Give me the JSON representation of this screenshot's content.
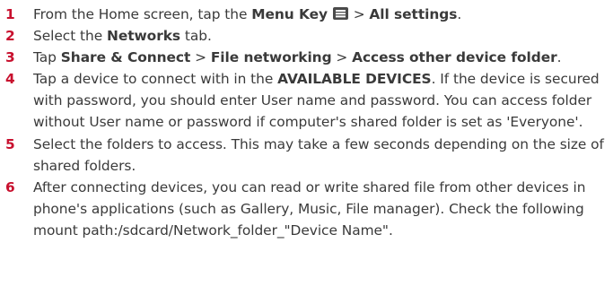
{
  "steps": [
    {
      "num": "1",
      "parts": [
        {
          "t": "From the Home screen, tap the "
        },
        {
          "t": "Menu Key",
          "b": true
        },
        {
          "t": " "
        },
        {
          "icon": "menu-key-icon"
        },
        {
          "t": " > "
        },
        {
          "t": "All settings",
          "b": true
        },
        {
          "t": "."
        }
      ]
    },
    {
      "num": "2",
      "parts": [
        {
          "t": "Select the "
        },
        {
          "t": "Networks",
          "b": true
        },
        {
          "t": " tab."
        }
      ]
    },
    {
      "num": "3",
      "parts": [
        {
          "t": "Tap "
        },
        {
          "t": "Share & Connect",
          "b": true
        },
        {
          "t": " > "
        },
        {
          "t": "File networking",
          "b": true
        },
        {
          "t": " > "
        },
        {
          "t": "Access other device folder",
          "b": true
        },
        {
          "t": "."
        }
      ]
    },
    {
      "num": "4",
      "parts": [
        {
          "t": "Tap a device to connect with in the "
        },
        {
          "t": "AVAILABLE DEVICES",
          "b": true
        },
        {
          "t": ". If the device is secured with password, you should enter User name and password. You can access folder without User name or password if computer's shared folder is set as 'Everyone'."
        }
      ]
    },
    {
      "num": "5",
      "parts": [
        {
          "t": "Select the folders to access. This may take a few seconds depending on the size of shared folders."
        }
      ]
    },
    {
      "num": "6",
      "parts": [
        {
          "t": "After connecting devices, you can read or write shared file from other devices in phone's applications (such as Gallery, Music, File manager). Check the following mount path:/sdcard/Network_folder_\"Device Name\"."
        }
      ]
    }
  ],
  "colors": {
    "step_number": "#c8102e",
    "body_text": "#3a3a3a"
  }
}
